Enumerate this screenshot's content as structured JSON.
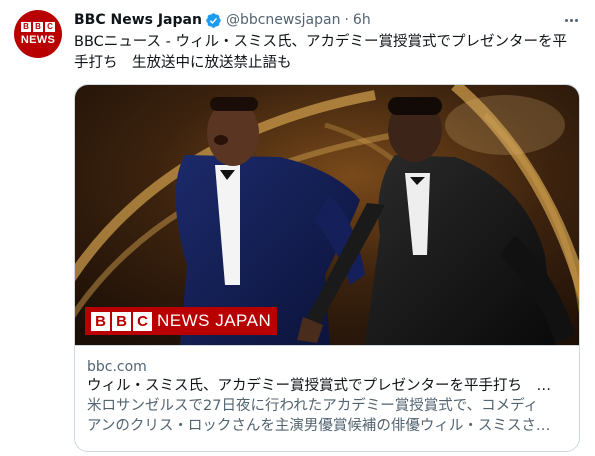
{
  "tweet": {
    "author": {
      "display_name": "BBC News Japan",
      "handle": "@bbcnewsjapan",
      "verified": true,
      "avatar": {
        "logo_letters": [
          "B",
          "B",
          "C"
        ],
        "logo_word": "NEWS",
        "color": "#b80000"
      }
    },
    "separator": "·",
    "time": "6h",
    "text_lines": [
      "BBCニュース - ウィル・スミス氏、アカデミー賞授賞式でプレゼンターを平",
      "手打ち　生放送中に放送禁止語も"
    ],
    "more_icon": "more-horizontal-icon"
  },
  "card": {
    "image": {
      "watermark_letters": [
        "B",
        "B",
        "C"
      ],
      "watermark_word": "NEWS JAPAN"
    },
    "domain": "bbc.com",
    "title": "ウィル・スミス氏、アカデミー賞授賞式でプレゼンターを平手打ち　…",
    "description_lines": [
      "米ロサンゼルスで27日夜に行われたアカデミー賞授賞式で、コメディ",
      "アンのクリス・ロックさんを主演男優賞候補の俳優ウィル・スミスさ…"
    ]
  },
  "colors": {
    "brand_red": "#b80000",
    "verified_blue": "#1d9bf0",
    "secondary_text": "#536471",
    "border": "#cfd9de"
  }
}
